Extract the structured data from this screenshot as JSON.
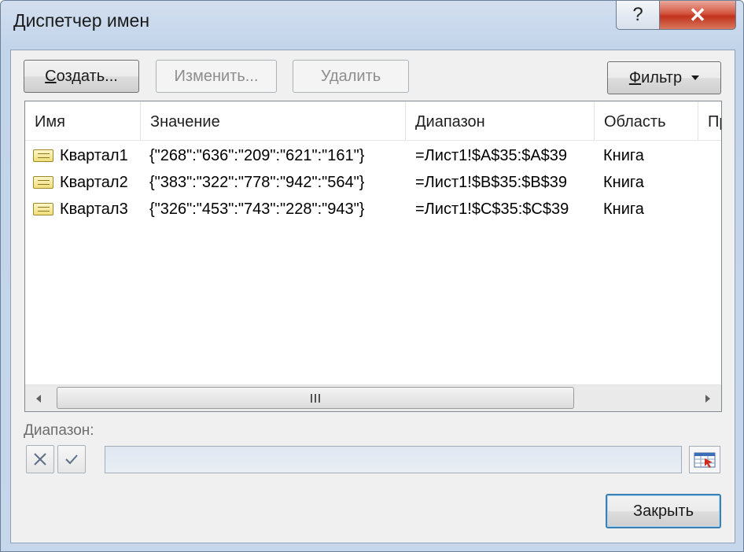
{
  "window": {
    "title": "Диспетчер имен",
    "help_glyph": "?",
    "close_glyph": "✕"
  },
  "toolbar": {
    "create_prefix": "С",
    "create_rest": "оздать...",
    "edit_label": "Изменить...",
    "delete_label": "Удалить",
    "filter_prefix": "Ф",
    "filter_rest": "ильтр"
  },
  "list": {
    "columns": [
      "Имя",
      "Значение",
      "Диапазон",
      "Область",
      "Пр"
    ],
    "rows": [
      {
        "name": "Квартал1",
        "value": "{\"268\":\"636\":\"209\":\"621\":\"161\"}",
        "range": "=Лист1!$A$35:$A$39",
        "scope": "Книга"
      },
      {
        "name": "Квартал2",
        "value": "{\"383\":\"322\":\"778\":\"942\":\"564\"}",
        "range": "=Лист1!$B$35:$B$39",
        "scope": "Книга"
      },
      {
        "name": "Квартал3",
        "value": "{\"326\":\"453\":\"743\":\"228\":\"943\"}",
        "range": "=Лист1!$C$35:$C$39",
        "scope": "Книга"
      }
    ]
  },
  "range_section": {
    "label": "Диапазон:",
    "value": ""
  },
  "footer": {
    "close_label": "Закрыть"
  },
  "icons": {
    "name_item": "defined-name-icon",
    "cancel": "cancel-x-icon",
    "confirm": "checkmark-icon",
    "picker": "range-select-icon"
  }
}
